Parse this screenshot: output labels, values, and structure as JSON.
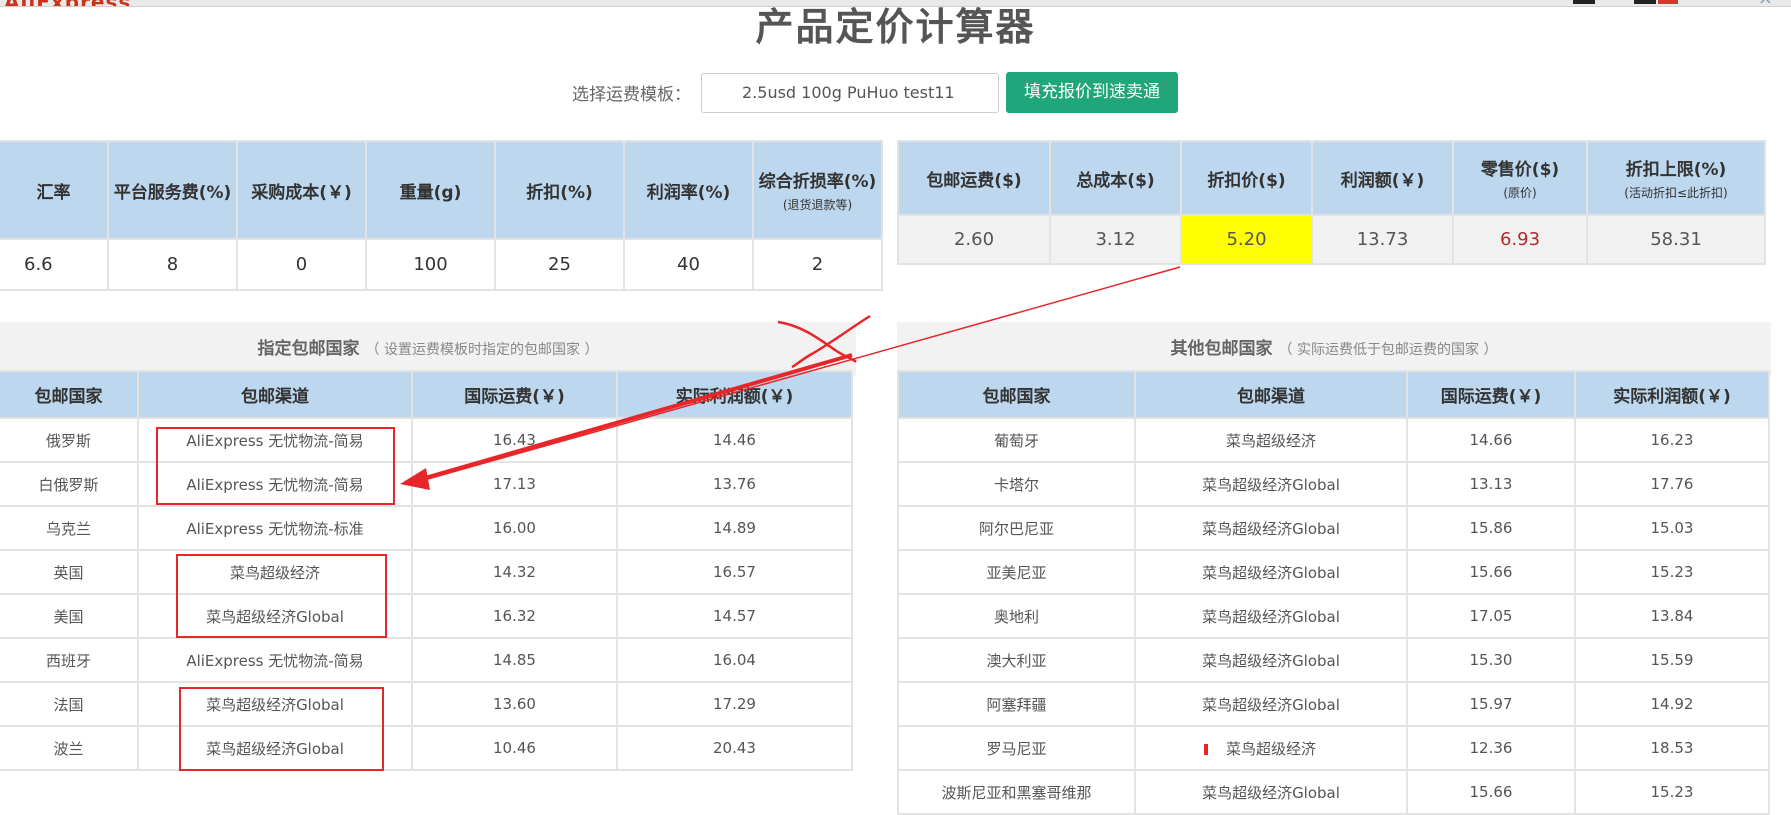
{
  "title": "产品定价计算器",
  "template": {
    "label": "选择运费模板：",
    "selected": "2.5usd 100g PuHuo test11",
    "fill_button": "填充报价到速卖通"
  },
  "params_table": {
    "headers": [
      {
        "main": "汇率",
        "sub": ""
      },
      {
        "main": "平台服务费(%)",
        "sub": ""
      },
      {
        "main": "采购成本(￥)",
        "sub": ""
      },
      {
        "main": "重量(g)",
        "sub": ""
      },
      {
        "main": "折扣(%)",
        "sub": ""
      },
      {
        "main": "利润率(%)",
        "sub": ""
      },
      {
        "main": "综合折损率(%)",
        "sub": "(退货退款等)"
      }
    ],
    "values": [
      "6.6",
      "8",
      "0",
      "100",
      "25",
      "40",
      "2"
    ]
  },
  "results_table": {
    "headers": [
      {
        "main": "包邮运费($)",
        "sub": ""
      },
      {
        "main": "总成本($)",
        "sub": ""
      },
      {
        "main": "折扣价($)",
        "sub": ""
      },
      {
        "main": "利润额(￥)",
        "sub": ""
      },
      {
        "main": "零售价($)",
        "sub": "(原价)"
      },
      {
        "main": "折扣上限(%)",
        "sub": "(活动折扣≤此折扣)"
      }
    ],
    "values": [
      "2.60",
      "3.12",
      "5.20",
      "13.73",
      "6.93",
      "58.31"
    ],
    "highlight_color": "#ffff00",
    "retail_color": "#b22a2a"
  },
  "specified": {
    "title": "指定包邮国家",
    "note": "（ 设置运费模板时指定的包邮国家 ）",
    "headers": [
      "包邮国家",
      "包邮渠道",
      "国际运费(￥)",
      "实际利润额(￥)"
    ],
    "rows": [
      [
        "俄罗斯",
        "AliExpress 无忧物流-简易",
        "16.43",
        "14.46"
      ],
      [
        "白俄罗斯",
        "AliExpress 无忧物流-简易",
        "17.13",
        "13.76"
      ],
      [
        "乌克兰",
        "AliExpress 无忧物流-标准",
        "16.00",
        "14.89"
      ],
      [
        "英国",
        "菜鸟超级经济",
        "14.32",
        "16.57"
      ],
      [
        "美国",
        "菜鸟超级经济Global",
        "16.32",
        "14.57"
      ],
      [
        "西班牙",
        "AliExpress 无忧物流-简易",
        "14.85",
        "16.04"
      ],
      [
        "法国",
        "菜鸟超级经济Global",
        "13.60",
        "17.29"
      ],
      [
        "波兰",
        "菜鸟超级经济Global",
        "10.46",
        "20.43"
      ]
    ]
  },
  "other": {
    "title": "其他包邮国家",
    "note": "（ 实际运费低于包邮运费的国家 ）",
    "headers": [
      "包邮国家",
      "包邮渠道",
      "国际运费(￥)",
      "实际利润额(￥)"
    ],
    "rows": [
      [
        "葡萄牙",
        "菜鸟超级经济",
        "14.66",
        "16.23"
      ],
      [
        "卡塔尔",
        "菜鸟超级经济Global",
        "13.13",
        "17.76"
      ],
      [
        "阿尔巴尼亚",
        "菜鸟超级经济Global",
        "15.86",
        "15.03"
      ],
      [
        "亚美尼亚",
        "菜鸟超级经济Global",
        "15.66",
        "15.23"
      ],
      [
        "奥地利",
        "菜鸟超级经济Global",
        "17.05",
        "13.84"
      ],
      [
        "澳大利亚",
        "菜鸟超级经济Global",
        "15.30",
        "15.59"
      ],
      [
        "阿塞拜疆",
        "菜鸟超级经济Global",
        "15.97",
        "14.92"
      ],
      [
        "罗马尼亚",
        "菜鸟超级经济",
        "12.36",
        "18.53"
      ],
      [
        "波斯尼亚和黑塞哥维那",
        "菜鸟超级经济Global",
        "15.66",
        "15.23"
      ]
    ]
  },
  "annotation_color": "#e8262a"
}
